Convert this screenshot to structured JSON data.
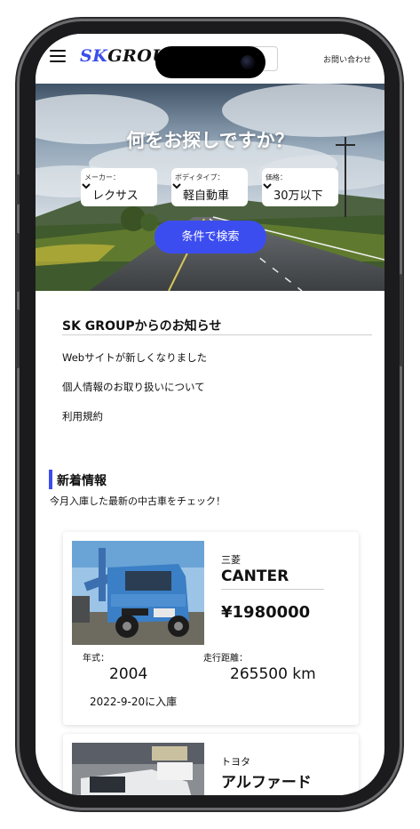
{
  "header": {
    "logo_sk": "SK",
    "logo_group": "GROUP",
    "contact_label": "お問い合わせ"
  },
  "hero": {
    "title": "何をお探しですか？",
    "selects": [
      {
        "label": "メーカー：",
        "value": "レクサス"
      },
      {
        "label": "ボディタイプ：",
        "value": "軽自動車"
      },
      {
        "label": "価格：",
        "value": "30万以下"
      }
    ],
    "search_button": "条件で検索"
  },
  "news": {
    "title": "SK GROUPからのお知らせ",
    "items": [
      "Webサイトが新しくなりました",
      "個人情報のお取り扱いについて",
      "利用規約"
    ]
  },
  "new_arrivals": {
    "title": "新着情報",
    "subtitle": "今月入庫した最新の中古車をチェック！",
    "cars": [
      {
        "maker": "三菱",
        "model": "CANTER",
        "price": "¥1980000",
        "year_label": "年式：",
        "year": "2004",
        "mileage_label": "走行距離：",
        "mileage": "265500 km",
        "arrived": "2022-9-20に入庫"
      },
      {
        "maker": "トヨタ",
        "model": "アルファード"
      }
    ]
  },
  "colors": {
    "accent": "#3c4df0",
    "logo_blue": "#3a4ee8"
  }
}
